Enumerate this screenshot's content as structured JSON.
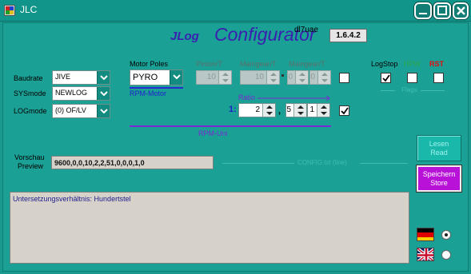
{
  "window": {
    "title": "JLC"
  },
  "header": {
    "app_name": "JLog",
    "configurator": "Configurator",
    "author": "dl7uae",
    "version": "1.6.4.2"
  },
  "left_settings": {
    "baudrate_label": "Baudrate",
    "baudrate_value": "JIVE",
    "sysmode_label": "SYSmode",
    "sysmode_value": "NEWLOG",
    "logmode_label": "LOGmode",
    "logmode_value": "(0) OF/LV"
  },
  "motor": {
    "poles_label": "Motor Poles",
    "poles_value": "PYRO",
    "rpm_motor_label": "RPM-Motor"
  },
  "gears": {
    "pinion_label": "Pinion/T",
    "pinion_value": "10",
    "maingear_label": "Maingear/T",
    "maingear_value": "10",
    "maingear2_label": "Maingear/T",
    "maingear2_a": "0",
    "maingear2_b": "0",
    "ratio_label": "Ratio",
    "ratio_prefix": "1:",
    "ratio_int": "2",
    "ratio_sep": ",",
    "ratio_frac1": "5",
    "ratio_frac2": "1",
    "rpm_uni_label": "RPM-Uni"
  },
  "flags": {
    "logstop_label": "LogStop",
    "hpw_label": "HPW",
    "rst_label": "RST",
    "flags_label": "Flags",
    "logstop_checked": true,
    "hpw_checked": false,
    "rst_checked": false,
    "hpw_color": "#2fa84a",
    "rst_color": "#e01010"
  },
  "preview": {
    "label_line1": "Vorschau",
    "label_line2": "Preview",
    "value": "9600,0,0,10,2,2,51,0,0,0,1,0",
    "config_label": "CONFIG.txt (line)"
  },
  "buttons": {
    "lesen": "Lesen",
    "read": "Read",
    "speichern": "Speichern",
    "store": "Store"
  },
  "log": {
    "text": "Untersetzungsverhältnis: Hundertstel"
  },
  "language": {
    "german_selected": true,
    "english_selected": false
  }
}
